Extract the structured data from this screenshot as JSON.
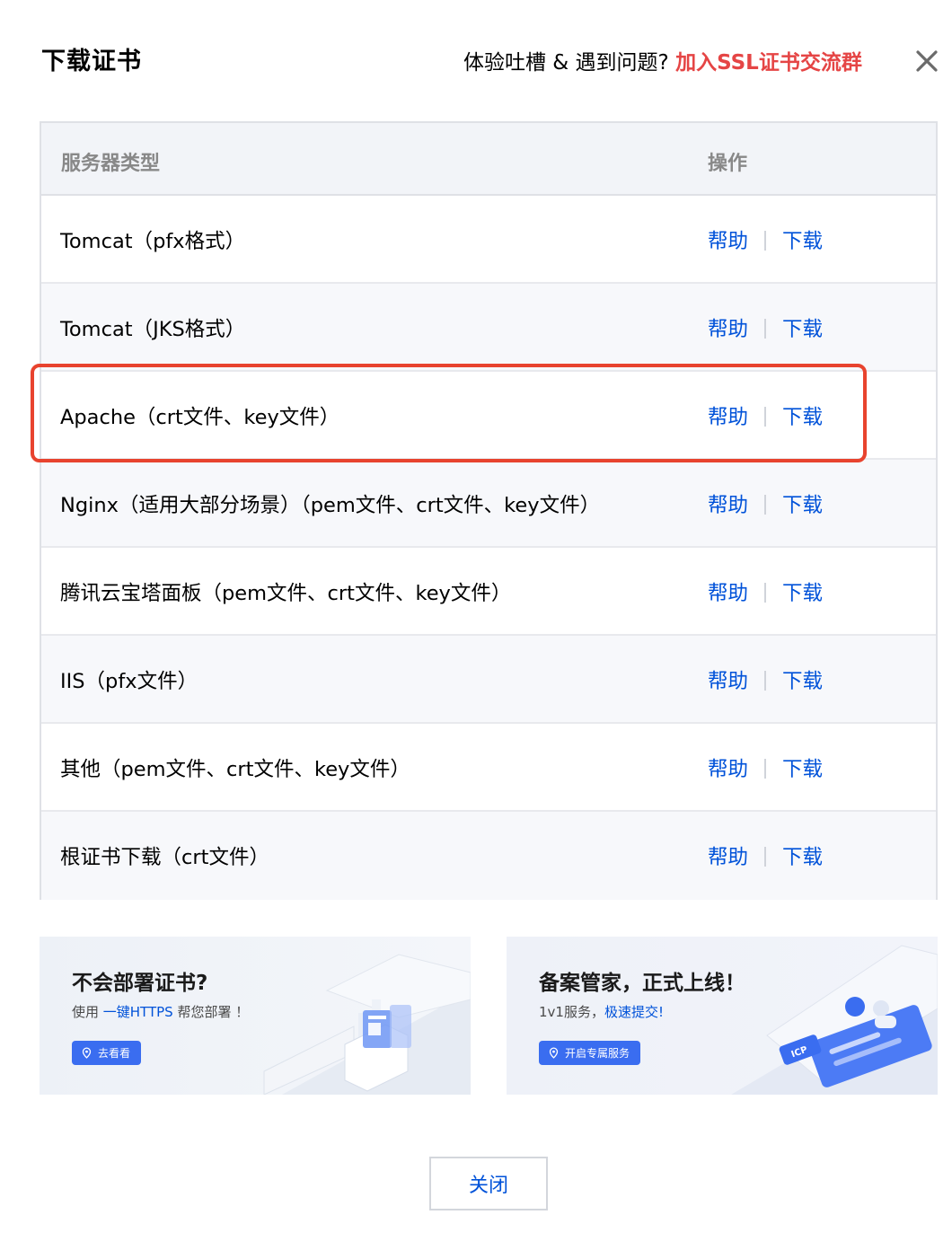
{
  "dialog": {
    "title": "下载证书",
    "feedback_text": "体验吐槽 & 遇到问题?",
    "feedback_link": "加入SSL证书交流群"
  },
  "table": {
    "headers": {
      "type": "服务器类型",
      "operation": "操作"
    },
    "help_label": "帮助",
    "download_label": "下载",
    "rows": [
      {
        "label": "Tomcat（pfx格式）"
      },
      {
        "label": "Tomcat（JKS格式）"
      },
      {
        "label": "Apache（crt文件、key文件）"
      },
      {
        "label": "Nginx（适用大部分场景）（pem文件、crt文件、key文件）"
      },
      {
        "label": "腾讯云宝塔面板（pem文件、crt文件、key文件）"
      },
      {
        "label": "IIS（pfx文件）"
      },
      {
        "label": "其他（pem文件、crt文件、key文件）"
      },
      {
        "label": "根证书下载（crt文件）"
      }
    ]
  },
  "banners": {
    "left": {
      "title": "不会部署证书?",
      "desc_prefix": "使用 ",
      "desc_link": "一键HTTPS",
      "desc_suffix": " 帮您部署 ！",
      "button": "去看看"
    },
    "right": {
      "title": "备案管家，正式上线！",
      "desc_prefix": "1v1服务，",
      "desc_link": "极速提交!",
      "button": "开启专属服务",
      "art_badge": "ICP"
    }
  },
  "footer": {
    "close_button": "关闭"
  },
  "colors": {
    "link": "#0052d9",
    "accent_red": "#e54545",
    "highlight_border": "#e8432e",
    "button_blue": "#3a6df0"
  },
  "icons": {
    "close": "close-x-icon",
    "location": "location-pin-icon"
  }
}
